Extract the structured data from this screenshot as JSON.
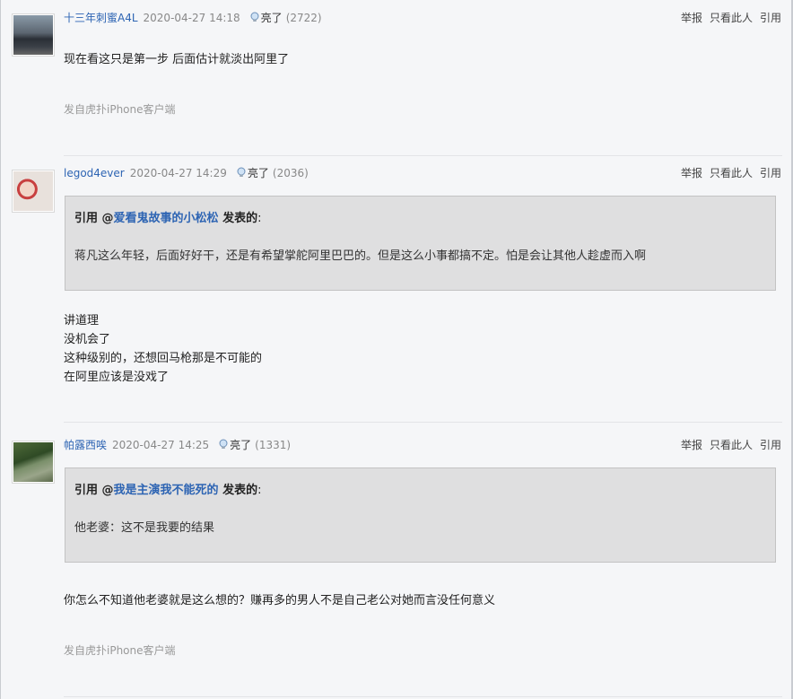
{
  "posts": [
    {
      "author": "十三年刺蜜A4L",
      "time": "2020-04-27 14:18",
      "light_label": "亮了",
      "light_count": "(2722)",
      "actions": {
        "report": "举报",
        "only_author": "只看此人",
        "quote": "引用"
      },
      "content": [
        "现在看这只是第一步 后面估计就淡出阿里了"
      ],
      "source": "发自虎扑iPhone客户端"
    },
    {
      "author": "legod4ever",
      "time": "2020-04-27 14:29",
      "light_label": "亮了",
      "light_count": "(2036)",
      "actions": {
        "report": "举报",
        "only_author": "只看此人",
        "quote": "引用"
      },
      "quote": {
        "prefix": "引用 @",
        "user": "爱看鬼故事的小松松",
        "suffix": " 发表的",
        "colon": ":",
        "text": "蒋凡这么年轻，后面好好干，还是有希望掌舵阿里巴巴的。但是这么小事都搞不定。怕是会让其他人趁虚而入啊"
      },
      "content": [
        "讲道理",
        "没机会了",
        "这种级别的，还想回马枪那是不可能的",
        "在阿里应该是没戏了"
      ]
    },
    {
      "author": "帕露西唉",
      "time": "2020-04-27 14:25",
      "light_label": "亮了",
      "light_count": "(1331)",
      "actions": {
        "report": "举报",
        "only_author": "只看此人",
        "quote": "引用"
      },
      "quote": {
        "prefix": "引用 @",
        "user": "我是主演我不能死的",
        "suffix": " 发表的",
        "colon": ":",
        "text": "他老婆：这不是我要的结果"
      },
      "content": [
        "你怎么不知道他老婆就是这么想的？赚再多的男人不是自己老公对她而言没任何意义"
      ],
      "source": "发自虎扑iPhone客户端"
    }
  ]
}
